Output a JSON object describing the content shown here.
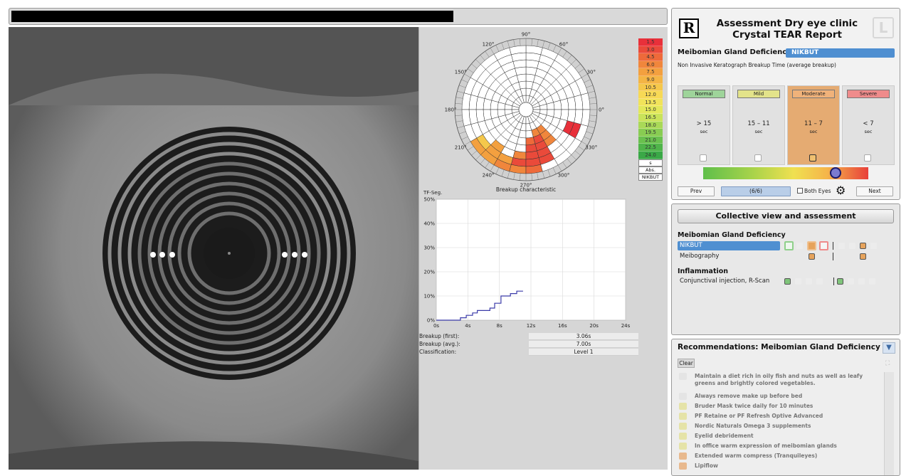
{
  "top_progress": {
    "fraction": 0.675
  },
  "polar": {
    "angle_labels": [
      "90°",
      "60°",
      "30°",
      "0°",
      "330°",
      "300°",
      "270°",
      "240°",
      "210°",
      "180°",
      "150°",
      "120°"
    ],
    "caption": "Breakup characteristic",
    "scale_values": [
      "1.5",
      "3.0",
      "4.5",
      "6.0",
      "7.5",
      "9.0",
      "10.5",
      "12.0",
      "13.5",
      "15.0",
      "16.5",
      "18.0",
      "19.5",
      "21.0",
      "22.5",
      "24.0"
    ],
    "scale_colors": [
      "#e8303a",
      "#ea4a3a",
      "#ee6a3a",
      "#f0863c",
      "#f3a03f",
      "#f4b545",
      "#f5c84b",
      "#f7d955",
      "#f1e35a",
      "#e3e85a",
      "#c9e35a",
      "#a9d957",
      "#88cc52",
      "#69c04e",
      "#4fb44a",
      "#3aa847"
    ],
    "scale_units": [
      "s",
      "Abs.",
      "NIKBUT"
    ]
  },
  "chart_data": {
    "type": "line",
    "title": "TF-Seg.",
    "xlabel": "",
    "ylabel": "TF-Seg.",
    "x_ticks": [
      "0s",
      "4s",
      "8s",
      "12s",
      "16s",
      "20s",
      "24s"
    ],
    "y_ticks": [
      "0%",
      "10%",
      "20%",
      "30%",
      "40%",
      "50%"
    ],
    "xlim": [
      0,
      24
    ],
    "ylim": [
      0,
      50
    ],
    "grid": true,
    "series": [
      {
        "points": [
          [
            0,
            0
          ],
          [
            3.06,
            0
          ],
          [
            3.06,
            1
          ],
          [
            3.8,
            1
          ],
          [
            3.8,
            2
          ],
          [
            4.6,
            2
          ],
          [
            4.6,
            3
          ],
          [
            5.2,
            3
          ],
          [
            5.2,
            4
          ],
          [
            6.8,
            4
          ],
          [
            6.8,
            5
          ],
          [
            7.4,
            5
          ],
          [
            7.4,
            7
          ],
          [
            8.2,
            7
          ],
          [
            8.2,
            10
          ],
          [
            9.4,
            10
          ],
          [
            9.4,
            11
          ],
          [
            10.2,
            11
          ],
          [
            10.2,
            12
          ],
          [
            11.0,
            12
          ]
        ]
      }
    ]
  },
  "stats": [
    {
      "label": "Breakup (first):",
      "value": "3.06s"
    },
    {
      "label": "Breakup (avg.):",
      "value": "7.00s"
    },
    {
      "label": "Classification:",
      "value": "Level 1"
    }
  ],
  "report": {
    "logo_left": "R",
    "logo_right": "L",
    "title_line1": "Assessment Dry eye clinic",
    "title_line2": "Crystal TEAR Report",
    "mgd_label": "Meibomian Gland Deficiency:",
    "mgd_value": "NIKBUT",
    "subtitle": "Non Invasive Keratograph Breakup Time (average breakup)",
    "severity": [
      {
        "tag": "Normal",
        "color": "#9ed49a",
        "range": "> 15",
        "unit": "sec",
        "active": false
      },
      {
        "tag": "Mild",
        "color": "#e3e38a",
        "range": "15 – 11",
        "unit": "sec",
        "active": false
      },
      {
        "tag": "Moderate",
        "color": "#f0b27a",
        "range": "11 – 7",
        "unit": "sec",
        "active": true
      },
      {
        "tag": "Severe",
        "color": "#ef8b8b",
        "range": "< 7",
        "unit": "sec",
        "active": false
      }
    ],
    "gradient_level": 0.8,
    "prev_label": "Prev",
    "pager": "(6/6)",
    "both_eyes_label": "Both Eyes",
    "next_label": "Next"
  },
  "collective": {
    "button_label": "Collective view and assessment",
    "groups": [
      {
        "title": "Meibomian Gland Deficiency",
        "rows": [
          "NIKBUT",
          "Meibography"
        ]
      },
      {
        "title": "Inflammation",
        "rows": [
          "Conjunctival injection, R-Scan"
        ]
      }
    ]
  },
  "recommendations": {
    "title": "Recommendations: Meibomian Gland Deficiency",
    "clear_label": "Clear",
    "items": [
      {
        "text": "Maintain a diet rich in oily fish and nuts as well as leafy greens and brightly colored vegetables.",
        "color": "#e4e4e4"
      },
      {
        "text": "Always remove make up before bed",
        "color": "#e4e4e4"
      },
      {
        "text": "Bruder Mask twice daily for 10 minutes",
        "color": "#e5e3a8"
      },
      {
        "text": "PF Retaine or PF Refresh Optive Advanced",
        "color": "#e5e3a8"
      },
      {
        "text": "Nordic Naturals Omega 3 supplements",
        "color": "#e5e3a8"
      },
      {
        "text": "Eyelid debridement",
        "color": "#e5e3a8"
      },
      {
        "text": "In office warm expression of meibomian glands",
        "color": "#e5e3a8"
      },
      {
        "text": "Extended warm compress (Tranquileyes)",
        "color": "#e8b98e"
      },
      {
        "text": "Lipiflow",
        "color": "#e8b98e"
      }
    ]
  }
}
